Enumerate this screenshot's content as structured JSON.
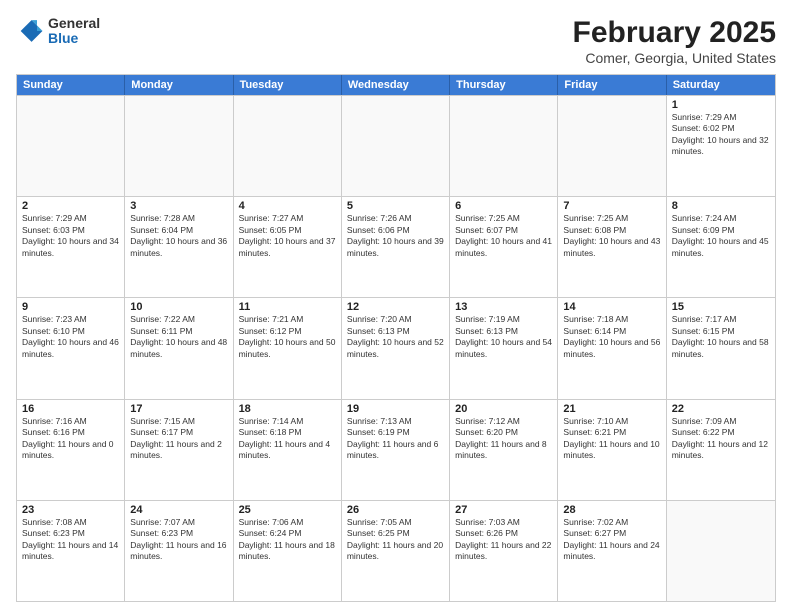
{
  "header": {
    "logo": {
      "general": "General",
      "blue": "Blue"
    },
    "title": "February 2025",
    "subtitle": "Comer, Georgia, United States"
  },
  "days_of_week": [
    "Sunday",
    "Monday",
    "Tuesday",
    "Wednesday",
    "Thursday",
    "Friday",
    "Saturday"
  ],
  "weeks": [
    [
      {
        "day": "",
        "empty": true
      },
      {
        "day": "",
        "empty": true
      },
      {
        "day": "",
        "empty": true
      },
      {
        "day": "",
        "empty": true
      },
      {
        "day": "",
        "empty": true
      },
      {
        "day": "",
        "empty": true
      },
      {
        "day": "1",
        "sunrise": "7:29 AM",
        "sunset": "6:02 PM",
        "daylight": "10 hours and 32 minutes."
      }
    ],
    [
      {
        "day": "2",
        "sunrise": "7:29 AM",
        "sunset": "6:03 PM",
        "daylight": "10 hours and 34 minutes."
      },
      {
        "day": "3",
        "sunrise": "7:28 AM",
        "sunset": "6:04 PM",
        "daylight": "10 hours and 36 minutes."
      },
      {
        "day": "4",
        "sunrise": "7:27 AM",
        "sunset": "6:05 PM",
        "daylight": "10 hours and 37 minutes."
      },
      {
        "day": "5",
        "sunrise": "7:26 AM",
        "sunset": "6:06 PM",
        "daylight": "10 hours and 39 minutes."
      },
      {
        "day": "6",
        "sunrise": "7:25 AM",
        "sunset": "6:07 PM",
        "daylight": "10 hours and 41 minutes."
      },
      {
        "day": "7",
        "sunrise": "7:25 AM",
        "sunset": "6:08 PM",
        "daylight": "10 hours and 43 minutes."
      },
      {
        "day": "8",
        "sunrise": "7:24 AM",
        "sunset": "6:09 PM",
        "daylight": "10 hours and 45 minutes."
      }
    ],
    [
      {
        "day": "9",
        "sunrise": "7:23 AM",
        "sunset": "6:10 PM",
        "daylight": "10 hours and 46 minutes."
      },
      {
        "day": "10",
        "sunrise": "7:22 AM",
        "sunset": "6:11 PM",
        "daylight": "10 hours and 48 minutes."
      },
      {
        "day": "11",
        "sunrise": "7:21 AM",
        "sunset": "6:12 PM",
        "daylight": "10 hours and 50 minutes."
      },
      {
        "day": "12",
        "sunrise": "7:20 AM",
        "sunset": "6:13 PM",
        "daylight": "10 hours and 52 minutes."
      },
      {
        "day": "13",
        "sunrise": "7:19 AM",
        "sunset": "6:13 PM",
        "daylight": "10 hours and 54 minutes."
      },
      {
        "day": "14",
        "sunrise": "7:18 AM",
        "sunset": "6:14 PM",
        "daylight": "10 hours and 56 minutes."
      },
      {
        "day": "15",
        "sunrise": "7:17 AM",
        "sunset": "6:15 PM",
        "daylight": "10 hours and 58 minutes."
      }
    ],
    [
      {
        "day": "16",
        "sunrise": "7:16 AM",
        "sunset": "6:16 PM",
        "daylight": "11 hours and 0 minutes."
      },
      {
        "day": "17",
        "sunrise": "7:15 AM",
        "sunset": "6:17 PM",
        "daylight": "11 hours and 2 minutes."
      },
      {
        "day": "18",
        "sunrise": "7:14 AM",
        "sunset": "6:18 PM",
        "daylight": "11 hours and 4 minutes."
      },
      {
        "day": "19",
        "sunrise": "7:13 AM",
        "sunset": "6:19 PM",
        "daylight": "11 hours and 6 minutes."
      },
      {
        "day": "20",
        "sunrise": "7:12 AM",
        "sunset": "6:20 PM",
        "daylight": "11 hours and 8 minutes."
      },
      {
        "day": "21",
        "sunrise": "7:10 AM",
        "sunset": "6:21 PM",
        "daylight": "11 hours and 10 minutes."
      },
      {
        "day": "22",
        "sunrise": "7:09 AM",
        "sunset": "6:22 PM",
        "daylight": "11 hours and 12 minutes."
      }
    ],
    [
      {
        "day": "23",
        "sunrise": "7:08 AM",
        "sunset": "6:23 PM",
        "daylight": "11 hours and 14 minutes."
      },
      {
        "day": "24",
        "sunrise": "7:07 AM",
        "sunset": "6:23 PM",
        "daylight": "11 hours and 16 minutes."
      },
      {
        "day": "25",
        "sunrise": "7:06 AM",
        "sunset": "6:24 PM",
        "daylight": "11 hours and 18 minutes."
      },
      {
        "day": "26",
        "sunrise": "7:05 AM",
        "sunset": "6:25 PM",
        "daylight": "11 hours and 20 minutes."
      },
      {
        "day": "27",
        "sunrise": "7:03 AM",
        "sunset": "6:26 PM",
        "daylight": "11 hours and 22 minutes."
      },
      {
        "day": "28",
        "sunrise": "7:02 AM",
        "sunset": "6:27 PM",
        "daylight": "11 hours and 24 minutes."
      },
      {
        "day": "",
        "empty": true
      }
    ]
  ]
}
